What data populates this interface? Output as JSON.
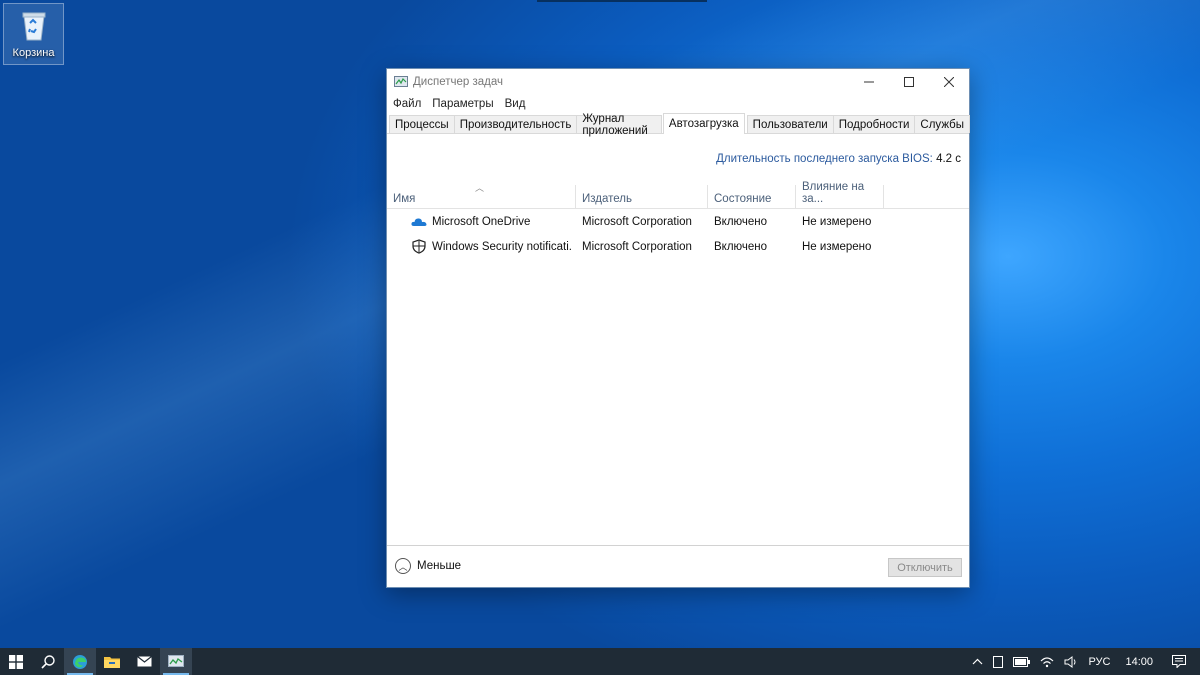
{
  "desktop": {
    "recycle_bin_label": "Корзина"
  },
  "window": {
    "title": "Диспетчер задач",
    "menu": [
      "Файл",
      "Параметры",
      "Вид"
    ],
    "tabs": [
      {
        "label": "Процессы",
        "active": false
      },
      {
        "label": "Производительность",
        "active": false
      },
      {
        "label": "Журнал приложений",
        "active": false
      },
      {
        "label": "Автозагрузка",
        "active": true
      },
      {
        "label": "Пользователи",
        "active": false
      },
      {
        "label": "Подробности",
        "active": false
      },
      {
        "label": "Службы",
        "active": false
      }
    ],
    "bios_label": "Длительность последнего запуска BIOS:",
    "bios_value": "4.2 с",
    "columns": [
      "Имя",
      "Издатель",
      "Состояние",
      "Влияние на за..."
    ],
    "rows": [
      {
        "icon": "onedrive-icon",
        "name": "Microsoft OneDrive",
        "publisher": "Microsoft Corporation",
        "status": "Включено",
        "impact": "Не измерено"
      },
      {
        "icon": "shield-icon",
        "name": "Windows Security notificati...",
        "publisher": "Microsoft Corporation",
        "status": "Включено",
        "impact": "Не измерено"
      }
    ],
    "fewer_label": "Меньше",
    "disable_label": "Отключить"
  },
  "taskbar": {
    "apps": [
      "start-icon",
      "search-icon",
      "edge-icon",
      "file-explorer-icon",
      "mail-icon",
      "task-manager-icon"
    ],
    "language": "РУС",
    "time": "14:00"
  },
  "colors": {
    "accent": "#0b5bbd",
    "taskbar": "#1f2b36",
    "link_text": "#2b5a9e"
  }
}
